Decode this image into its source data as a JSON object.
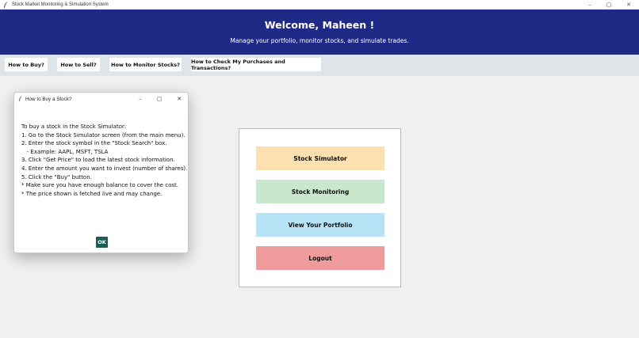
{
  "window": {
    "title": "Stock Market Monitoring & Simulation System",
    "icon": "feather-icon",
    "controls": [
      "minimize",
      "maximize",
      "close"
    ]
  },
  "header": {
    "title": "Welcome, Maheen !",
    "subtitle": "Manage your portfolio, monitor stocks, and simulate trades.",
    "background": "#1f2a86"
  },
  "help_buttons": [
    {
      "label": "How to Buy?"
    },
    {
      "label": "How to Sell?"
    },
    {
      "label": "How to Monitor Stocks?"
    },
    {
      "label": "How to Check My Purchases and Transactions?"
    }
  ],
  "main_menu": [
    {
      "label": "Stock Simulator",
      "color": "#fde0b0"
    },
    {
      "label": "Stock Monitoring",
      "color": "#c9e7cc"
    },
    {
      "label": "View Your Portfolio",
      "color": "#b7e3f7"
    },
    {
      "label": "Logout",
      "color": "#ee9b9b"
    }
  ],
  "dialog": {
    "title": "How to Buy a Stock?",
    "lines": [
      "To buy a stock in the Stock Simulator:",
      "",
      "1. Go to the Stock Simulator screen (from the main menu).",
      "2. Enter the stock symbol in the \"Stock Search\" box.",
      "   - Example: AAPL, MSFT, TSLA",
      "3. Click \"Get Price\" to load the latest stock information.",
      "4. Enter the amount you want to invest (number of shares).",
      "5. Click the \"Buy\" button.",
      "",
      "* Make sure you have enough balance to cover the cost.",
      "* The price shown is fetched live and may change."
    ],
    "ok_label": "OK",
    "ok_color": "#1b5e55"
  }
}
